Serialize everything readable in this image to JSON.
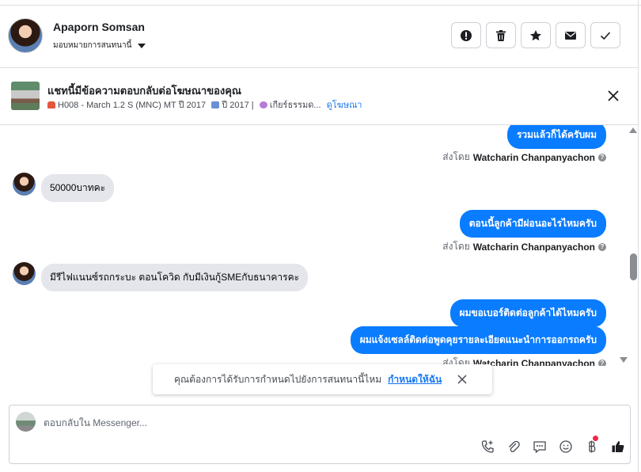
{
  "header": {
    "name": "Apaporn Somsan",
    "assign_label": "มอบหมายการสนทนานี้",
    "actions": [
      {
        "name": "report-button",
        "icon": "alert-icon"
      },
      {
        "name": "delete-button",
        "icon": "trash-icon"
      },
      {
        "name": "star-button",
        "icon": "star-icon"
      },
      {
        "name": "mark-unread-button",
        "icon": "envelope-icon"
      },
      {
        "name": "mark-done-button",
        "icon": "check-icon"
      }
    ]
  },
  "ad": {
    "title": "แชทนี้มีข้อความตอบกลับต่อโฆษณาของคุณ",
    "details": "H008 - March 1.2 S (MNC) MT ปี 2017",
    "year": "ปี 2017 |",
    "transmission": "เกียร์ธรรมด...",
    "view_ad_link": "ดูโฆษณา"
  },
  "messages": [
    {
      "direction": "out",
      "text": "รวมแล้วก็ได้ครับผม"
    },
    {
      "direction": "sent_by",
      "prefix": "ส่งโดย",
      "agent": "Watcharin Chanpanyachon"
    },
    {
      "direction": "in",
      "text": "50000บาทคะ"
    },
    {
      "direction": "out",
      "text": "ตอนนี้ลูกค้ามีผ่อนอะไรไหมครับ"
    },
    {
      "direction": "sent_by",
      "prefix": "ส่งโดย",
      "agent": "Watcharin Chanpanyachon"
    },
    {
      "direction": "in",
      "text": "มีรีไฟแนนซ์รถกระบะ ตอนโควิด กับมีเงินกู้SMEกับธนาคารคะ"
    },
    {
      "direction": "out",
      "text": "ผมขอเบอร์ติดต่อลูกค้าได้ไหมครับ"
    },
    {
      "direction": "out",
      "text": "ผมแจ้งเซลล์ติดต่อพูดคุยรายละเอียดแนะนำการออกรถครับ"
    },
    {
      "direction": "sent_by",
      "prefix": "ส่งโดย",
      "agent": "Watcharin Chanpanyachon"
    }
  ],
  "toast": {
    "text": "คุณต้องการได้รับการกำหนดไปยังการสนทนานี้ไหม",
    "action": "กำหนดให้ฉัน"
  },
  "composer": {
    "placeholder": "ตอบกลับใน Messenger..."
  },
  "colors": {
    "accent": "#0a7cff",
    "incoming_bubble": "#e4e6eb",
    "link": "#1877f2",
    "notification_dot": "#f02849"
  }
}
